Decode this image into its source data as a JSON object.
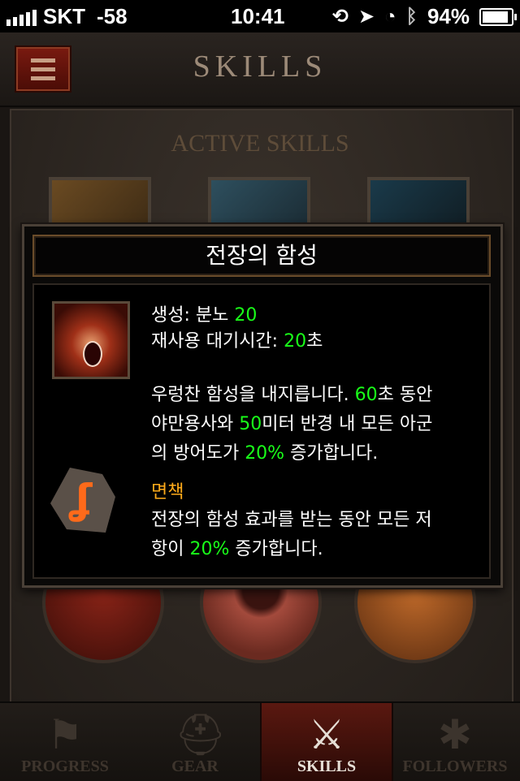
{
  "status_bar": {
    "carrier": "SKT",
    "signal_dbm": "-58",
    "time": "10:41",
    "battery": "94%"
  },
  "header": {
    "title": "SKILLS"
  },
  "section": {
    "title": "ACTIVE SKILLS"
  },
  "tooltip": {
    "title": "전장의 함성",
    "generate_label": "생성: 분노 ",
    "generate_value": "20",
    "cooldown_label": "재사용 대기시간: ",
    "cooldown_value": "20",
    "cooldown_unit": "초",
    "desc_line1_a": "우렁찬 함성을 내지릅니다. ",
    "desc_line1_b": "60",
    "desc_line1_c": "초 동안",
    "desc_line2_a": "야만용사와 ",
    "desc_line2_b": "50",
    "desc_line2_c": "미터 반경 내 모든 아군",
    "desc_line3_a": "의 방어도가 ",
    "desc_line3_b": "20%",
    "desc_line3_c": " 증가합니다.",
    "rune_name": "면책",
    "rune_line1": "전장의 함성 효과를 받는 동안 모든 저",
    "rune_line2_a": "항이 ",
    "rune_line2_b": "20%",
    "rune_line2_c": " 증가합니다."
  },
  "tabs": [
    {
      "label": "PROGRESS",
      "icon": "banner-icon"
    },
    {
      "label": "GEAR",
      "icon": "helmet-icon"
    },
    {
      "label": "SKILLS",
      "icon": "crossed-swords-icon",
      "selected": true
    },
    {
      "label": "FOLLOWERS",
      "icon": "asterisk-icon"
    }
  ],
  "colors": {
    "highlight_green": "#19ff19",
    "rune_orange": "#ffab1a",
    "selected_tab": "#5a1810"
  }
}
